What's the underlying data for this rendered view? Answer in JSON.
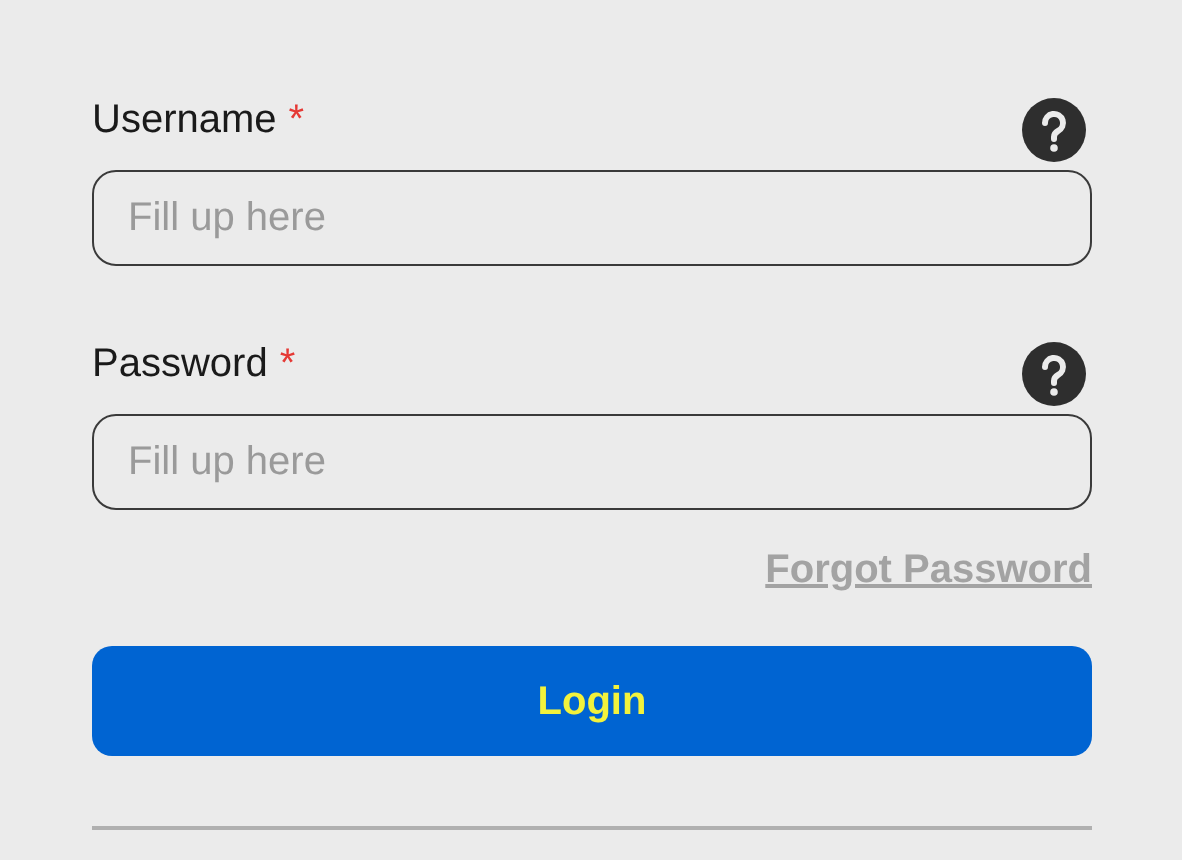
{
  "fields": [
    {
      "label": "Username",
      "required_mark": "*",
      "placeholder": "Fill up here"
    },
    {
      "label": "Password",
      "required_mark": "*",
      "placeholder": "Fill up here"
    }
  ],
  "forgot_link": "Forgot Password",
  "login_button": "Login"
}
